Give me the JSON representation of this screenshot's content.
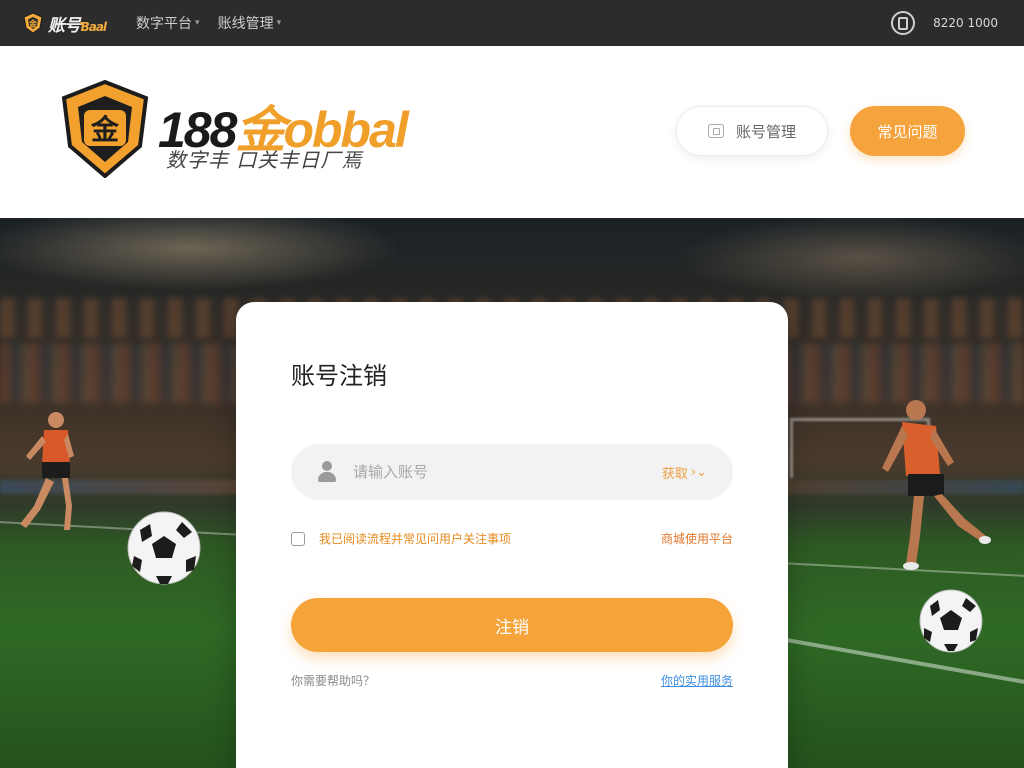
{
  "topbar": {
    "brand_main": "账号",
    "brand_accent": "Ɓaal",
    "nav": [
      {
        "label": "数字平台",
        "has_dropdown": true
      },
      {
        "label": "账线管理",
        "has_dropdown": true
      }
    ],
    "phone": "8220 1000"
  },
  "header": {
    "logo_number": "188",
    "logo_gold": "金",
    "logo_text": "obbal",
    "logo_sub": "数字丰 口关丰日厂焉",
    "account_button": "账号管理",
    "help_button": "常见问题"
  },
  "card": {
    "title": "账号注销",
    "input_placeholder": "请输入账号",
    "input_action": "获取",
    "agree_text": "我已阅读流程并常见问用户关注事项",
    "agree_link": "商城使用平台",
    "submit": "注销",
    "footer_left": "你需要帮助吗？",
    "footer_right": "你的实用服务"
  },
  "colors": {
    "accent": "#f5a33c",
    "topbar": "#2c2c2c",
    "link_blue": "#3d8ee0"
  }
}
